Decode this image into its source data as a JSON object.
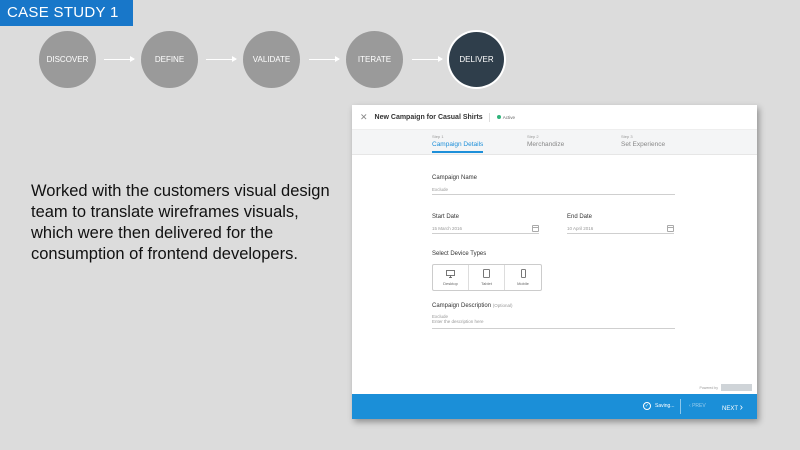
{
  "case_tag": "CASE STUDY 1",
  "process_steps": [
    "DISCOVER",
    "DEFINE",
    "VALIDATE",
    "ITERATE",
    "DELIVER"
  ],
  "description": "Worked with the customers visual design team to translate wireframes visuals, which were then delivered for the consumption of frontend developers.",
  "app": {
    "title": "New Campaign for Casual Shirts",
    "status": "Active",
    "tabs": [
      {
        "step": "Step 1",
        "label": "Campaign Details"
      },
      {
        "step": "Step 2",
        "label": "Merchandize"
      },
      {
        "step": "Step 3",
        "label": "Set Experience"
      }
    ],
    "form": {
      "campaign_name_label": "Campaign Name",
      "campaign_name_value": "Exclude",
      "start_date_label": "Start Date",
      "start_date_value": "15 March 2016",
      "end_date_label": "End Date",
      "end_date_value": "10 April 2016",
      "device_label": "Select Device Types",
      "devices": [
        "Desktop",
        "Tablet",
        "Mobile"
      ],
      "description_label": "Campaign Description",
      "description_optional": "(Optional)",
      "description_value": "Exclude",
      "description_placeholder": "Enter the description here"
    },
    "powered_by": "Powered by",
    "footer": {
      "saving": "Saving...",
      "prev": "PREV",
      "next": "NEXT"
    }
  },
  "colors": {
    "accent": "#1877c9",
    "footer": "#1b8fd8",
    "step_inactive": "#9a9a9a",
    "step_active": "#2f3e4b",
    "status_active": "#2fb37a"
  }
}
